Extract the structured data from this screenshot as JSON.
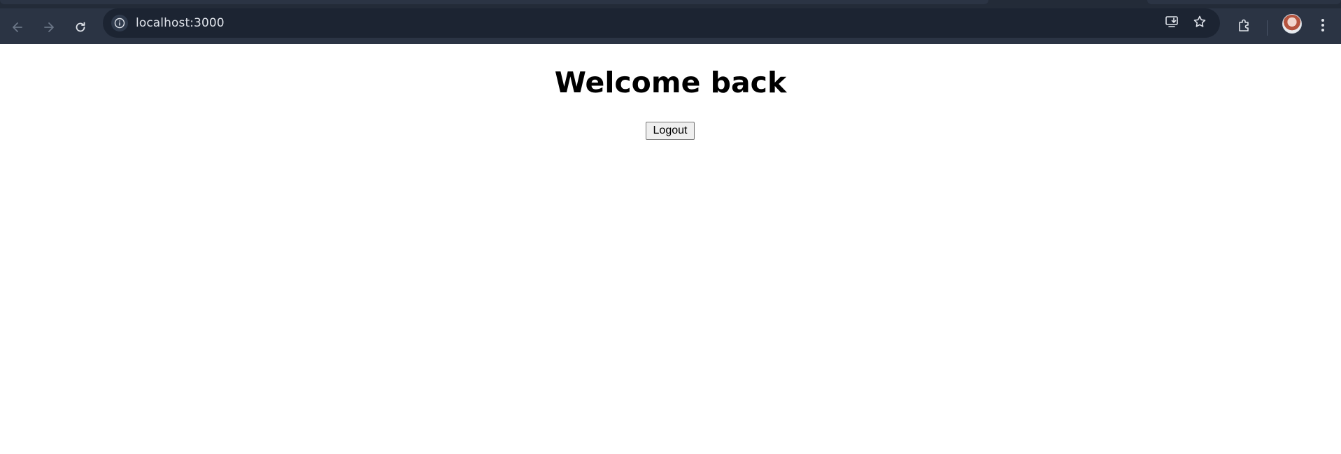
{
  "browser": {
    "url": "localhost:3000",
    "icons": {
      "back": "back-arrow-icon",
      "forward": "forward-arrow-icon",
      "reload": "reload-icon",
      "site_info": "info-icon",
      "install_app": "install-app-icon",
      "bookmark": "star-icon",
      "extensions": "puzzle-icon",
      "profile": "avatar",
      "menu": "kebab-menu-icon"
    }
  },
  "page": {
    "heading": "Welcome back",
    "logout_label": "Logout"
  }
}
